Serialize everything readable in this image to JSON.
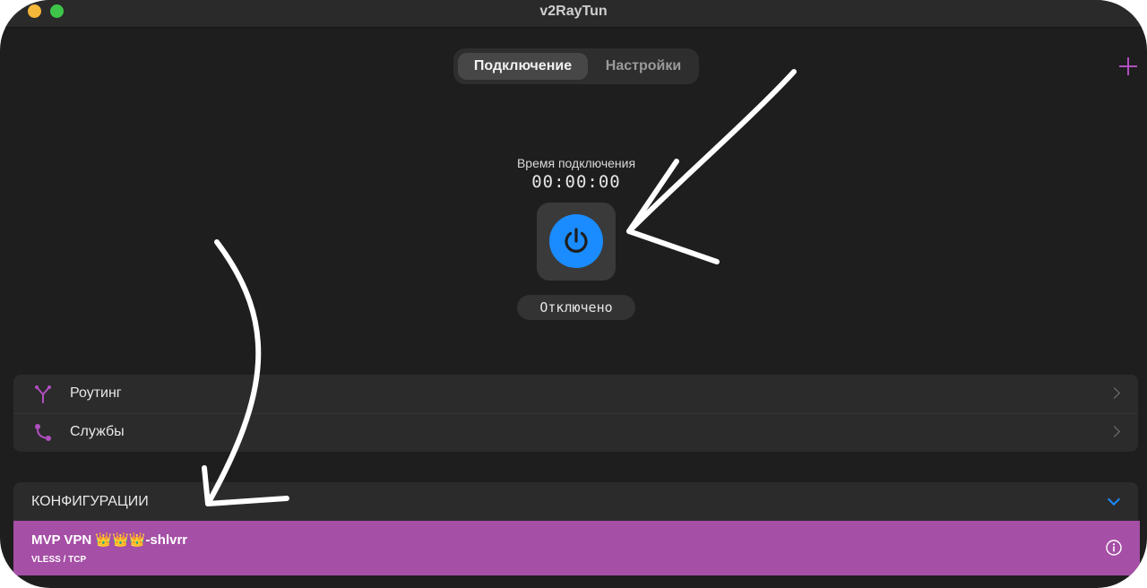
{
  "window": {
    "title": "v2RayTun"
  },
  "tabs": [
    {
      "label": "Подключение",
      "active": true
    },
    {
      "label": "Настройки",
      "active": false
    }
  ],
  "connection": {
    "time_label": "Время подключения",
    "time_value": "00:00:00",
    "status": "Отключено"
  },
  "menu": {
    "items": [
      {
        "label": "Роутинг",
        "icon": "routing-icon"
      },
      {
        "label": "Службы",
        "icon": "services-icon"
      }
    ]
  },
  "configs": {
    "header": "КОНФИГУРАЦИИ",
    "items": [
      {
        "name": "MVP VPN 👑👑👑-shlvrr",
        "protocol": "VLESS / TCP"
      }
    ]
  },
  "colors": {
    "accent_blue": "#1a8cff",
    "accent_purple": "#a54fa6",
    "background": "#1e1e1e"
  }
}
